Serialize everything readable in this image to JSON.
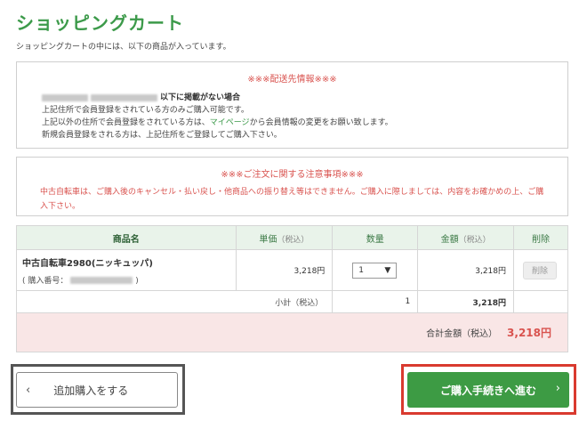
{
  "page": {
    "title": "ショッピングカート",
    "intro": "ショッピングカートの中には、以下の商品が入っています。"
  },
  "shipping": {
    "heading": "※※※配送先情報※※※",
    "line1_suffix": "以下に掲載がない場合",
    "line2": "上記住所で会員登録をされている方のみご購入可能です。",
    "line3_a": "上記以外の住所で会員登録をされている方は、",
    "line3_link": "マイページ",
    "line3_b": "から会員情報の変更をお願い致します。",
    "line4": "新規会員登録をされる方は、上記住所をご登録してご購入下さい。"
  },
  "notice": {
    "heading": "※※※ご注文に関する注意事項※※※",
    "body": "中古自転車は、ご購入後のキャンセル・払い戻し・他商品への振り替え等はできません。ご購入に際しましては、内容をお確かめの上、ご購入下さい。"
  },
  "cart": {
    "headers": {
      "name": "商品名",
      "unit_price": "単価",
      "unit_price_sub": "（税込）",
      "quantity": "数量",
      "amount": "金額",
      "amount_sub": "（税込）",
      "delete": "削除"
    },
    "items": [
      {
        "name": "中古自転車2980(ニッキュッパ)",
        "number_label": "( 購入番号：",
        "number_close": ")",
        "unit_price": "3,218円",
        "quantity": "1",
        "amount": "3,218円",
        "delete_label": "削除"
      }
    ],
    "subtotal": {
      "label": "小計（税込）",
      "quantity": "1",
      "amount": "3,218円"
    },
    "total": {
      "label": "合計金額（税込）",
      "amount": "3,218円"
    }
  },
  "buttons": {
    "continue_shopping": "追加購入をする",
    "checkout": "ご購入手続きへ進む"
  },
  "colors": {
    "brand_green": "#3c9a4a",
    "alert_red": "#d9534f",
    "checkout_green": "#3d9b44",
    "highlight_red": "#d93a2f"
  }
}
